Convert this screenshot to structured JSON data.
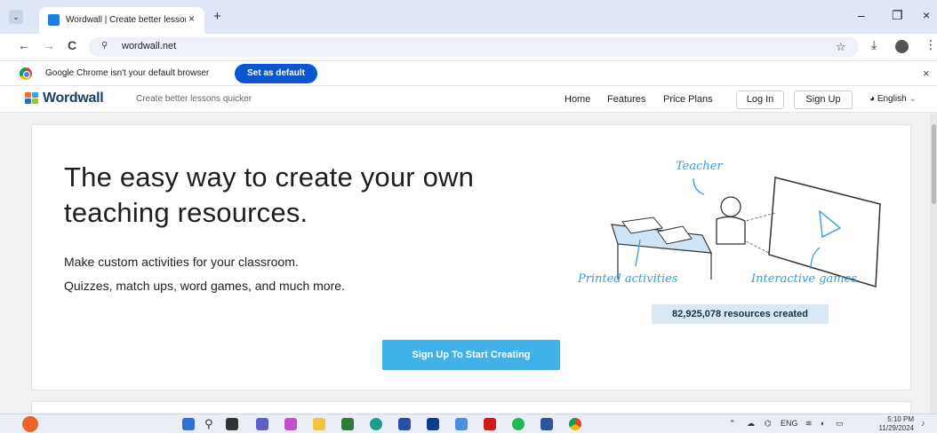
{
  "browser": {
    "tab_title": "Wordwall | Create better lesson",
    "tab_close": "×",
    "new_tab": "+",
    "window_controls": {
      "minimize": "–",
      "restore": "❐",
      "close": "×"
    },
    "nav": {
      "back": "←",
      "forward": "→",
      "reload": "C"
    },
    "url": "wordwall.net",
    "infobar": {
      "message": "Google Chrome isn't your default browser",
      "button": "Set as default",
      "close": "×"
    },
    "icons": [
      "tab-list-icon",
      "back-icon",
      "forward-icon",
      "reload-icon",
      "site-info-icon",
      "star-icon",
      "download-icon",
      "profile-avatar",
      "menu-icon",
      "chrome-logo-icon"
    ]
  },
  "site": {
    "brand": "Wordwall",
    "tagline": "Create better lessons quicker",
    "nav": [
      "Home",
      "Features",
      "Price Plans"
    ],
    "login": "Log In",
    "signup": "Sign Up",
    "language": "English",
    "accent_color": "#41b1ea",
    "brand_color": "#1d3e6e"
  },
  "hero": {
    "title": "The easy way to create your own teaching resources.",
    "subtitle1": "Make custom activities for your classroom.",
    "subtitle2": "Quizzes, match ups, word games, and much more.",
    "cta": "Sign Up To Start Creating",
    "resources_count": "82,925,078 resources created",
    "illustration_labels": {
      "teacher": "Teacher",
      "printed": "Printed activities",
      "interactive": "Interactive games"
    }
  },
  "taskbar": {
    "lang": "ENG",
    "time": "5:10 PM",
    "date": "11/29/2024",
    "apps": [
      "weather-icon",
      "windows-start-icon",
      "search-icon",
      "task-view-icon",
      "chat-icon",
      "copilot-icon",
      "file-explorer-icon",
      "calculator-icon",
      "edge-icon",
      "app-l-icon",
      "dropbox-icon",
      "settings-icon",
      "netflix-icon",
      "spotify-icon",
      "word-icon",
      "chrome-icon"
    ]
  }
}
